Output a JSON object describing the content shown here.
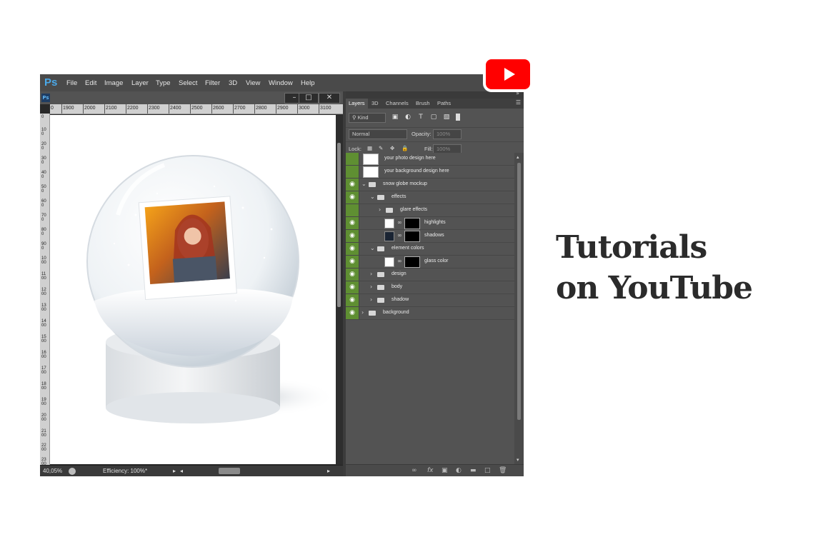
{
  "app": {
    "logo": "Ps",
    "menu": [
      "File",
      "Edit",
      "Image",
      "Layer",
      "Type",
      "Select",
      "Filter",
      "3D",
      "View",
      "Window",
      "Help"
    ]
  },
  "document": {
    "tab_icon": "Ps",
    "window_buttons": [
      "minimize-icon",
      "maximize-icon",
      "close-icon"
    ],
    "ruler_h": [
      "0",
      "1900",
      "2000",
      "2100",
      "2200",
      "2300",
      "2400",
      "2500",
      "2600",
      "2700",
      "2800",
      "2900",
      "3000",
      "3100"
    ],
    "ruler_v": [
      "0",
      "100",
      "200",
      "300",
      "400",
      "500",
      "600",
      "700",
      "800",
      "900",
      "1000",
      "1100",
      "1200",
      "1300",
      "1400",
      "1500",
      "1600",
      "1700",
      "1800",
      "1900",
      "2000",
      "2100",
      "2200",
      "2300"
    ],
    "zoom": "40,05%",
    "efficiency": "Efficiency: 100%*"
  },
  "layers_panel": {
    "tabs": [
      "Layers",
      "3D",
      "Channels",
      "Brush",
      "Paths"
    ],
    "kind_label": "Kind",
    "blend_mode": "Normal",
    "opacity_label": "Opacity:",
    "opacity_value": "100%",
    "lock_label": "Lock:",
    "fill_label": "Fill:",
    "fill_value": "100%",
    "layers": [
      {
        "name": "your photo design here",
        "visible": false,
        "type": "smart"
      },
      {
        "name": "your background design here",
        "visible": false,
        "type": "smart"
      },
      {
        "name": "snow globe mockup",
        "visible": true,
        "type": "group",
        "expanded": true
      },
      {
        "name": "effects",
        "visible": true,
        "type": "group",
        "expanded": true
      },
      {
        "name": "glare effects",
        "visible": false,
        "type": "group",
        "expanded": false
      },
      {
        "name": "highlights",
        "visible": true,
        "type": "masked"
      },
      {
        "name": "shadows",
        "visible": true,
        "type": "masked"
      },
      {
        "name": "element colors",
        "visible": true,
        "type": "group",
        "expanded": true
      },
      {
        "name": "glass color",
        "visible": true,
        "type": "masked"
      },
      {
        "name": "design",
        "visible": true,
        "type": "group",
        "expanded": false
      },
      {
        "name": "body",
        "visible": true,
        "type": "group",
        "expanded": false
      },
      {
        "name": "shadow",
        "visible": true,
        "type": "group",
        "expanded": false
      },
      {
        "name": "background",
        "visible": true,
        "type": "group",
        "expanded": false
      }
    ]
  },
  "headline": {
    "line1": "Tutorials",
    "line2": "on YouTube"
  },
  "colors": {
    "youtube_red": "#ff0000",
    "eye_green": "#5f8f32",
    "headline": "#2b2b2b"
  }
}
